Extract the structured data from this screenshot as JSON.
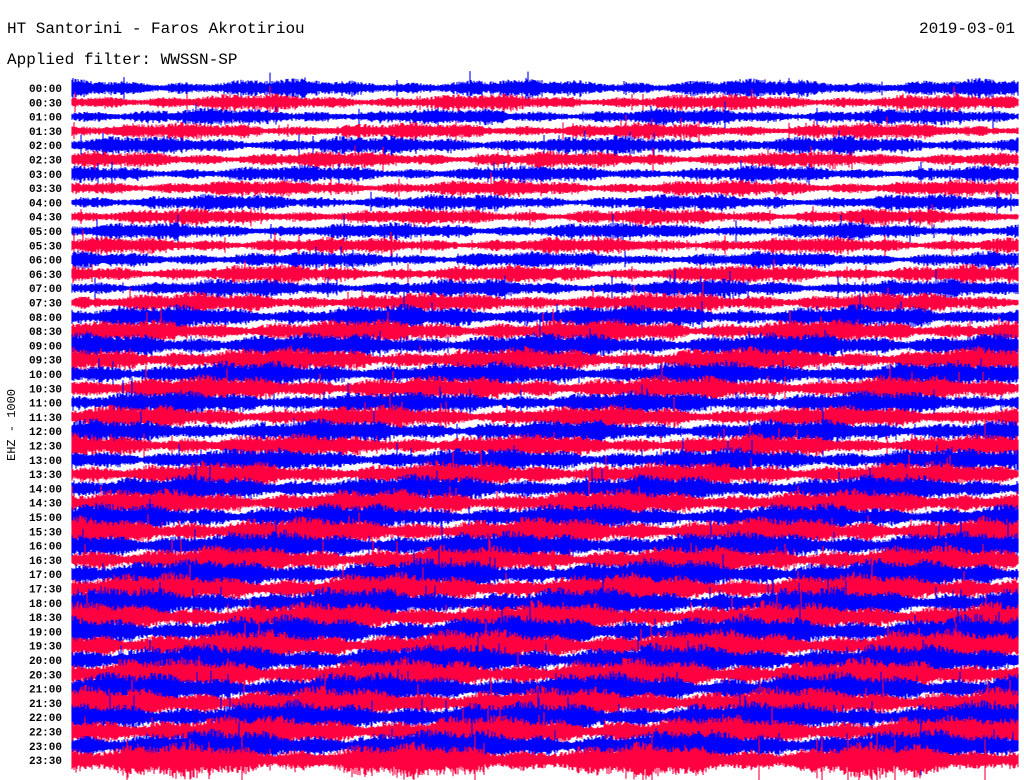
{
  "header": {
    "station": "HT Santorini - Faros Akrotiriou",
    "date": "2019-03-01",
    "filter": "Applied filter: WWSSN-SP"
  },
  "chart_data": {
    "type": "line",
    "title": "HT Santorini - Faros Akrotiriou",
    "ylabel": "EHZ - 1000",
    "colors": [
      "#0000ff",
      "#ff0040"
    ],
    "rows": [
      "00:00",
      "00:30",
      "01:00",
      "01:30",
      "02:00",
      "02:30",
      "03:00",
      "03:30",
      "04:00",
      "04:30",
      "05:00",
      "05:30",
      "06:00",
      "06:30",
      "07:00",
      "07:30",
      "08:00",
      "08:30",
      "09:00",
      "09:30",
      "10:00",
      "10:30",
      "11:00",
      "11:30",
      "12:00",
      "12:30",
      "13:00",
      "13:30",
      "14:00",
      "14:30",
      "15:00",
      "15:30",
      "16:00",
      "16:30",
      "17:00",
      "17:30",
      "18:00",
      "18:30",
      "19:00",
      "19:30",
      "20:00",
      "20:30",
      "21:00",
      "21:30",
      "22:00",
      "22:30",
      "23:00",
      "23:30"
    ],
    "relative_amplitude": [
      1.0,
      0.9,
      0.9,
      0.9,
      1.0,
      0.9,
      0.9,
      0.9,
      0.9,
      0.9,
      0.9,
      0.9,
      0.9,
      1.0,
      1.0,
      1.1,
      1.3,
      1.3,
      1.4,
      1.4,
      1.4,
      1.4,
      1.3,
      1.3,
      1.3,
      1.3,
      1.3,
      1.4,
      1.5,
      1.5,
      1.5,
      1.6,
      1.6,
      1.6,
      1.7,
      1.7,
      1.7,
      1.7,
      1.8,
      1.8,
      1.8,
      1.8,
      1.8,
      1.8,
      1.8,
      1.8,
      1.8,
      1.9
    ],
    "x_range_minutes": [
      0,
      30
    ]
  }
}
